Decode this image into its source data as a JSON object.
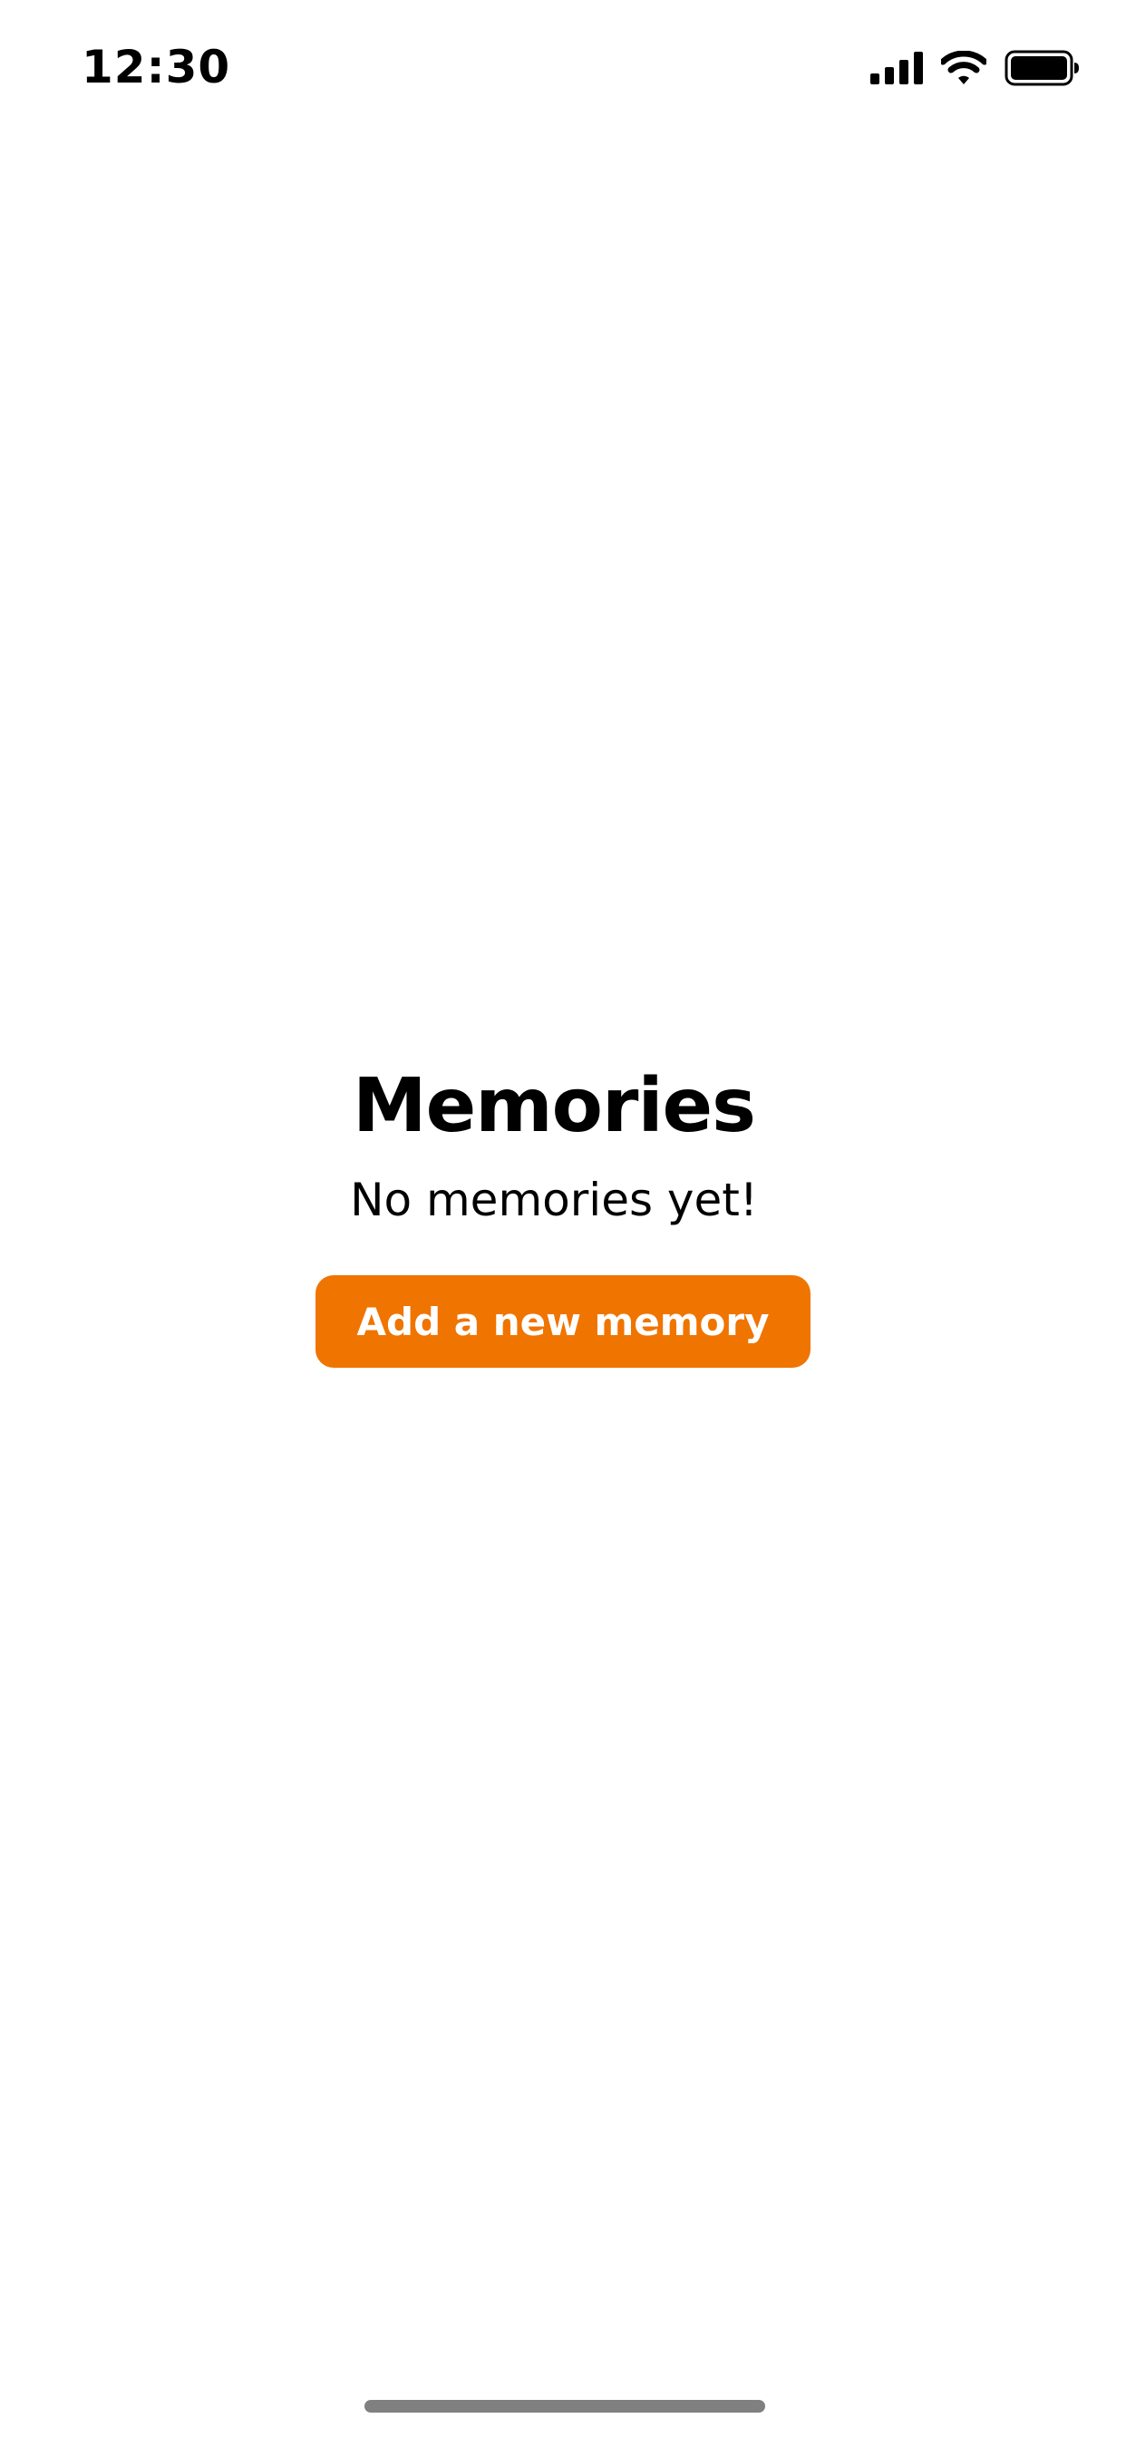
{
  "status_bar": {
    "time": "12:30",
    "icons": [
      "cellular-signal-icon",
      "wifi-icon",
      "battery-icon"
    ]
  },
  "main": {
    "title": "Memories",
    "empty_message": "No memories yet!",
    "add_button_label": "Add a new memory"
  },
  "colors": {
    "accent": "#f07400",
    "background": "#ffffff",
    "text": "#000000",
    "home_indicator": "#808080"
  }
}
